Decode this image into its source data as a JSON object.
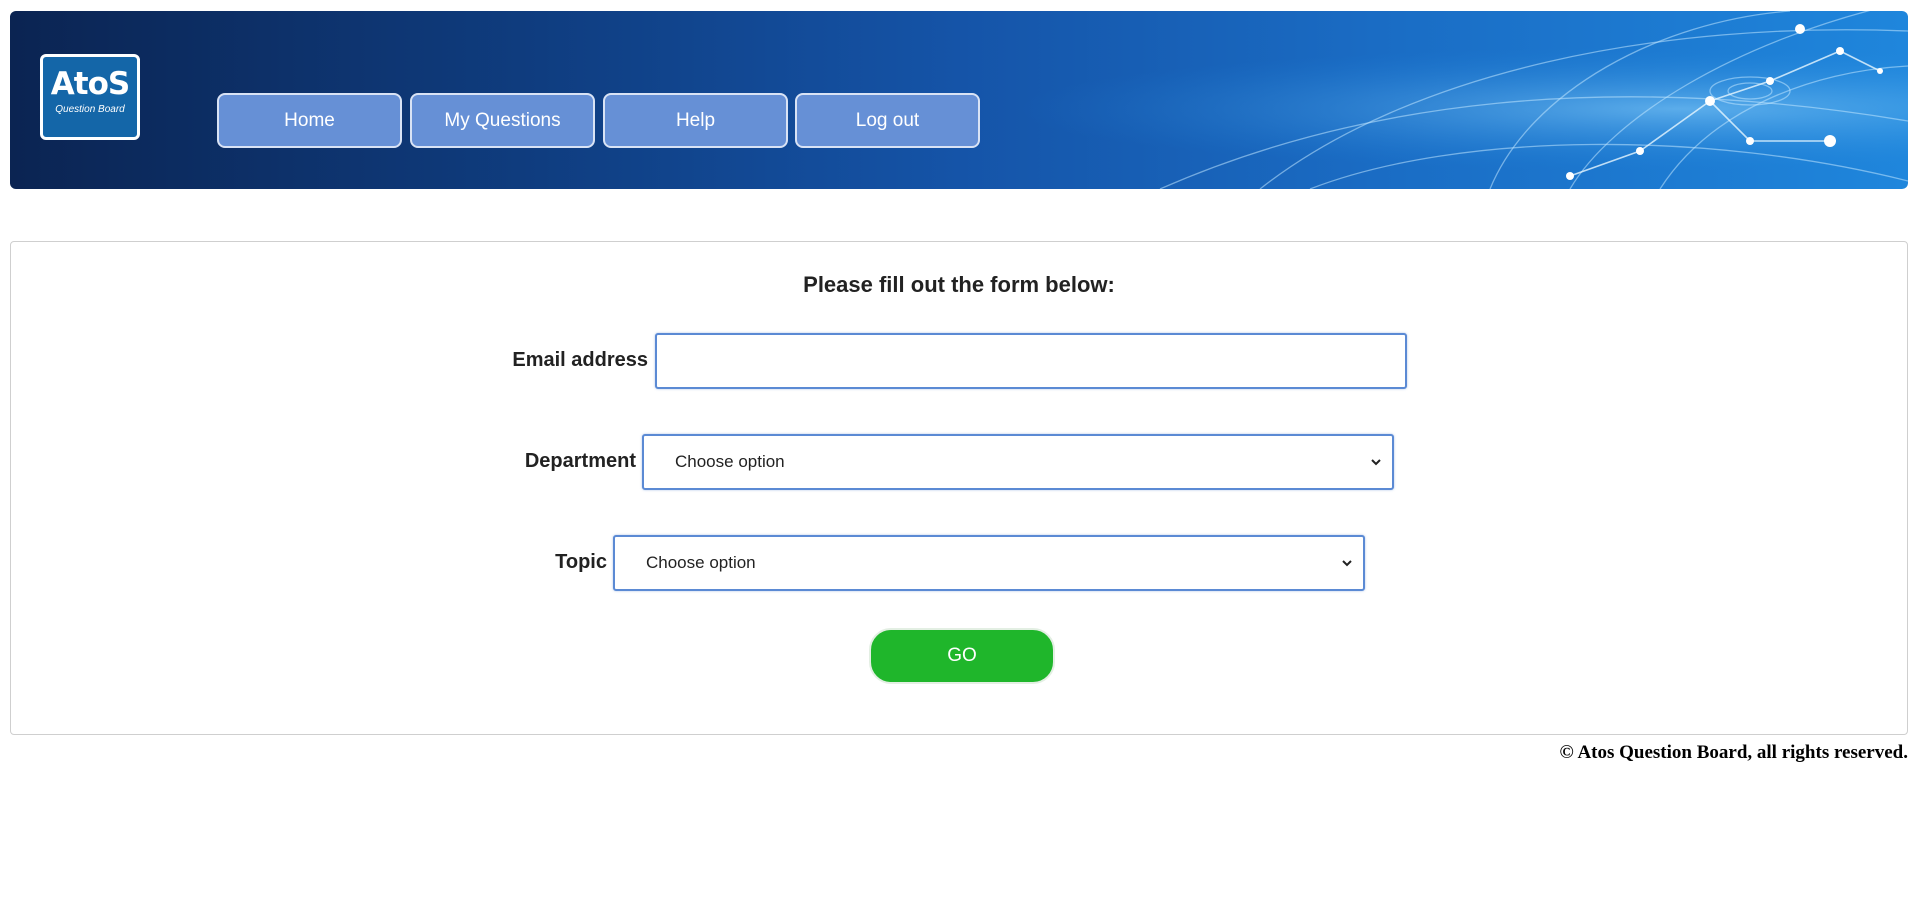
{
  "header": {
    "logo": {
      "brand": "AtoS",
      "subtitle": "Question Board"
    },
    "nav": [
      {
        "label": "Home"
      },
      {
        "label": "My Questions"
      },
      {
        "label": "Help"
      },
      {
        "label": "Log out"
      }
    ]
  },
  "form": {
    "title": "Please fill out the form below:",
    "email": {
      "label": "Email address",
      "value": "",
      "placeholder": ""
    },
    "department": {
      "label": "Department",
      "selected": "Choose option"
    },
    "topic": {
      "label": "Topic",
      "selected": "Choose option"
    },
    "submit_label": "GO"
  },
  "footer": {
    "copyright": "© Atos Question Board, all rights reserved."
  },
  "colors": {
    "header_dark": "#0b2452",
    "header_light": "#1f86dc",
    "nav_button": "#6690d6",
    "input_border": "#5b8ad4",
    "go_button": "#1fb62b"
  },
  "icons": {
    "select_arrow": "chevron-down-icon"
  }
}
